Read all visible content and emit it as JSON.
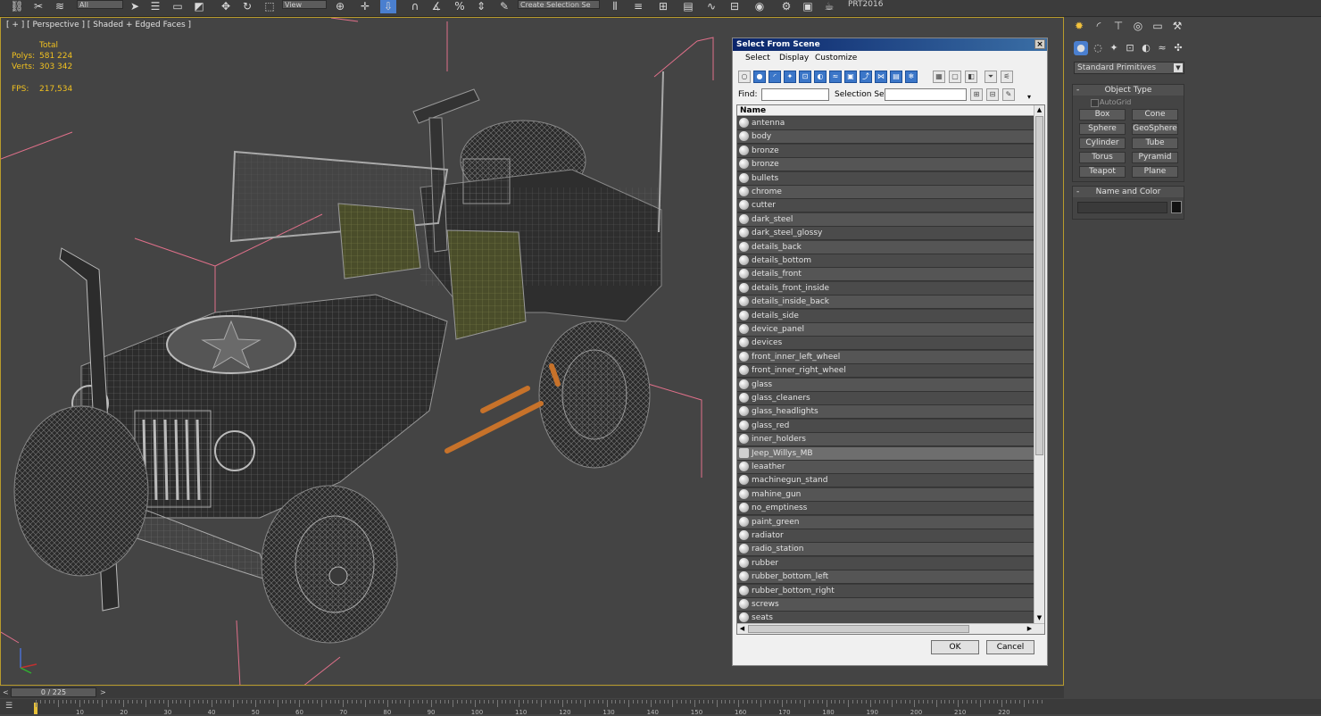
{
  "toolbar": {
    "view_combo": "View",
    "all_combo": "All",
    "selection_set_combo": "Create Selection Se",
    "project_label": "PRT2016"
  },
  "viewport": {
    "label": "[ + ] [ Perspective ] [ Shaded + Edged Faces ]",
    "stats": {
      "header": "Total",
      "polys_label": "Polys:",
      "polys": "581 224",
      "verts_label": "Verts:",
      "verts": "303 342",
      "fps_label": "FPS:",
      "fps": "217,534"
    },
    "axis": {
      "x": "x",
      "y": "y",
      "z": "z"
    }
  },
  "dialog": {
    "title": "Select From Scene",
    "close": "×",
    "menu": [
      "Select",
      "Display",
      "Customize"
    ],
    "find_label": "Find:",
    "selection_set_label": "Selection Set:",
    "column_name": "Name",
    "objects": [
      "antenna",
      "body",
      "bronze",
      "bronze",
      "bullets",
      "chrome",
      "cutter",
      "dark_steel",
      "dark_steel_glossy",
      "details_back",
      "details_bottom",
      "details_front",
      "details_front_inside",
      "details_inside_back",
      "details_side",
      "device_panel",
      "devices",
      "front_inner_left_wheel",
      "front_inner_right_wheel",
      "glass",
      "glass_cleaners",
      "glass_headlights",
      "glass_red",
      "inner_holders",
      "Jeep_Willys_MB",
      "leaather",
      "machinegun_stand",
      "mahine_gun",
      "no_emptiness",
      "paint_green",
      "radiator",
      "radio_station",
      "rubber",
      "rubber_bottom_left",
      "rubber_bottom_right",
      "screws",
      "seats"
    ],
    "selected_object": "Jeep_Willys_MB",
    "ok": "OK",
    "cancel": "Cancel"
  },
  "command_panel": {
    "category_dropdown": "Standard Primitives",
    "object_type": {
      "title": "Object Type",
      "autogrid": "AutoGrid",
      "buttons": [
        "Box",
        "Cone",
        "Sphere",
        "GeoSphere",
        "Cylinder",
        "Tube",
        "Torus",
        "Pyramid",
        "Teapot",
        "Plane"
      ]
    },
    "name_and_color": {
      "title": "Name and Color"
    }
  },
  "timeline": {
    "frame": "0 / 225",
    "ticks": [
      "10",
      "20",
      "30",
      "40",
      "50",
      "60",
      "70",
      "80",
      "90",
      "100",
      "110",
      "120",
      "130",
      "140",
      "150",
      "160",
      "170",
      "180",
      "190",
      "200",
      "210",
      "220"
    ]
  },
  "colors": {
    "viewport_bg": "#444444",
    "active_border": "#b89b2c",
    "stats_text": "#f0c020",
    "bbox_lines": "#e0708a",
    "dialog_title": "#0a246a"
  }
}
